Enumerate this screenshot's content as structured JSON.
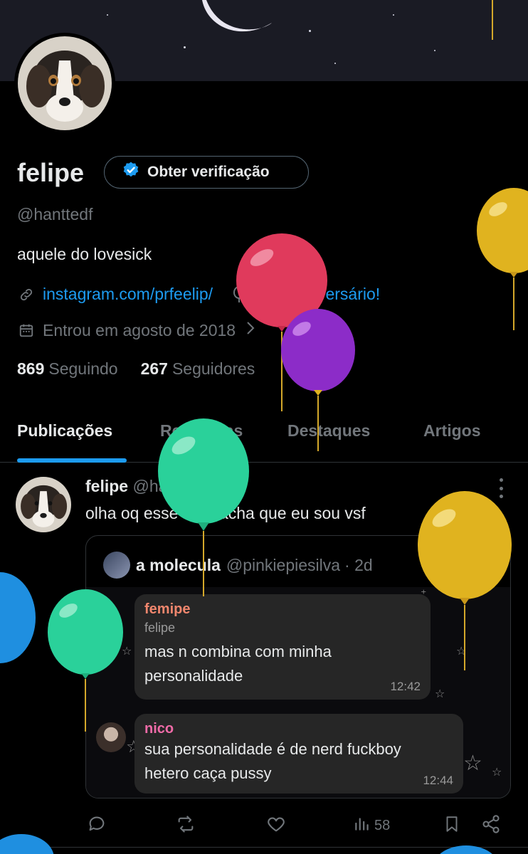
{
  "profile": {
    "name": "felipe",
    "verify_label": "Obter verificação",
    "handle": "@hanttedf",
    "bio": "aquele do lovesick",
    "link": "instagram.com/prfeelip/",
    "birthday": "Feliz Aniversário!",
    "joined": "Entrou em agosto de 2018",
    "following_count": "869",
    "following_label": "Seguindo",
    "followers_count": "267",
    "followers_label": "Seguidores"
  },
  "tabs": [
    "Publicações",
    "Respostas",
    "Destaques",
    "Artigos"
  ],
  "post": {
    "author": "felipe",
    "handle": "@hanttedf",
    "time": "· 2d",
    "text": "olha oq esse cara acha que eu sou vsf",
    "quote": {
      "author": "a molecula",
      "handle": "@pinkiepiesilva",
      "time": "· 2d",
      "chat": [
        {
          "who": "femipe",
          "sub": "felipe",
          "msg1": "mas n combina com minha",
          "msg2": "personalidade",
          "time": "12:42"
        },
        {
          "who": "nico",
          "msg1": "sua personalidade é de nerd fuckboy",
          "msg2": "hetero caça pussy",
          "time": "12:44"
        }
      ]
    },
    "views": "58"
  },
  "colors": {
    "accent": "#1d9bf0",
    "femipe_name": "#f0866d",
    "nico_name": "#f06ba8"
  },
  "icons": [
    "link-icon",
    "balloon-icon",
    "calendar-icon",
    "verified-badge-icon",
    "reply-icon",
    "repost-icon",
    "like-icon",
    "views-icon",
    "bookmark-icon",
    "share-icon",
    "more-icon"
  ]
}
